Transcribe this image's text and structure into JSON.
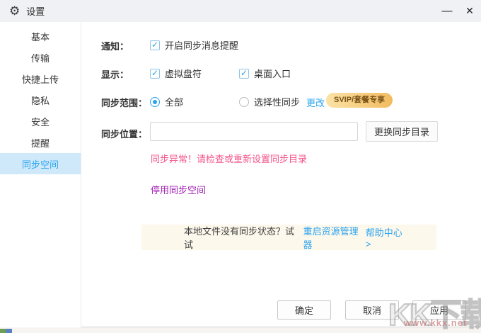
{
  "window": {
    "title": "设置",
    "minimize_label": "—",
    "close_label": "✕"
  },
  "sidebar": {
    "items": [
      {
        "label": "基本"
      },
      {
        "label": "传输"
      },
      {
        "label": "快捷上传"
      },
      {
        "label": "隐私"
      },
      {
        "label": "安全"
      },
      {
        "label": "提醒"
      },
      {
        "label": "同步空间"
      }
    ],
    "selected": "同步空间"
  },
  "settings": {
    "notification": {
      "label": "通知：",
      "option": "开启同步消息提醒",
      "checked": true
    },
    "display": {
      "label": "显示：",
      "options": [
        {
          "label": "虚拟盘符",
          "checked": true
        },
        {
          "label": "桌面入口",
          "checked": true
        }
      ]
    },
    "scope": {
      "label": "同步范围：",
      "option_all": "全部",
      "option_selective": "选择性同步",
      "selected": "全部",
      "change_link": "更改",
      "badge": "SVIP/套餐专享"
    },
    "location": {
      "label": "同步位置：",
      "value": "",
      "button": "更换同步目录"
    },
    "error_message": "同步异常！请检查或重新设置同步目录",
    "disable_link": "停用同步空间",
    "notice": {
      "question": "本地文件没有同步状态？试试",
      "action_link": "重启资源管理器",
      "help_link": "帮助中心 >"
    }
  },
  "footer": {
    "ok": "确定",
    "cancel": "取消",
    "apply": "应用"
  },
  "watermark": {
    "brand": "KK下载",
    "site": "www.kkx.net"
  },
  "colors": {
    "accent": "#2aa3ef",
    "error": "#f4558a",
    "disable_link": "#a11cb4",
    "sidebar_selected_bg": "#cfe9fb",
    "badge_bg": "#f1bb60",
    "badge_text": "#7a5218",
    "notice_bg": "#fdf8ec",
    "titlebar_bg": "#eff1f5"
  }
}
